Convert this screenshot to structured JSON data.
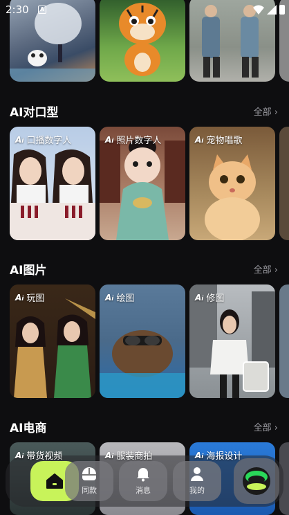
{
  "status": {
    "time": "2:30"
  },
  "sections": [
    {
      "title": "AI对口型",
      "more": "全部 ›",
      "cards": [
        {
          "label": "口播数字人"
        },
        {
          "label": "照片数字人"
        },
        {
          "label": "宠物唱歌"
        }
      ]
    },
    {
      "title": "AI图片",
      "more": "全部 ›",
      "cards": [
        {
          "label": "玩图"
        },
        {
          "label": "绘图"
        },
        {
          "label": "修图"
        }
      ]
    },
    {
      "title": "AI电商",
      "more": "全部 ›",
      "cards": [
        {
          "label": "带货视频"
        },
        {
          "label": "服装商拍"
        },
        {
          "label": "海报设计"
        }
      ]
    }
  ],
  "ai_badge": "A",
  "nav": {
    "home_icon": "home-icon",
    "items": [
      {
        "label": "同款",
        "icon": "template-icon"
      },
      {
        "label": "消息",
        "icon": "bell-icon"
      },
      {
        "label": "我的",
        "icon": "user-icon"
      }
    ]
  },
  "colors": {
    "accent": "#c8f35a",
    "background": "#0e0e10"
  }
}
